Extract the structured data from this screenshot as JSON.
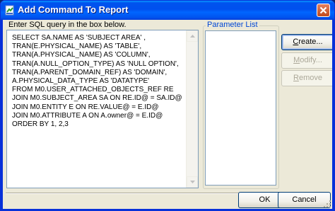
{
  "window": {
    "title": "Add Command To Report"
  },
  "prompt": "Enter SQL query in the box below.",
  "sql_lines": [
    "SELECT SA.NAME AS 'SUBJECT AREA' ,",
    "TRAN(E.PHYSICAL_NAME) AS 'TABLE',",
    "TRAN(A.PHYSICAL_NAME) AS 'COLUMN',",
    "TRAN(A.NULL_OPTION_TYPE) AS 'NULL OPTION',",
    "TRAN(A.PARENT_DOMAIN_REF) AS 'DOMAIN',",
    "A.PHYSICAL_DATA_TYPE AS 'DATATYPE'",
    "FROM M0.USER_ATTACHED_OBJECTS_REF RE",
    "JOIN M0.SUBJECT_AREA SA ON RE.ID@ = SA.ID@",
    "JOIN M0.ENTITY E ON RE.VALUE@ = E.ID@",
    "JOIN M0.ATTRIBUTE A ON A.owner@ = E.ID@",
    "ORDER BY 1, 2,3"
  ],
  "parameter_list": {
    "legend": "Parameter List"
  },
  "buttons": {
    "create": {
      "label": "Create...",
      "enabled": true
    },
    "modify": {
      "label": "Modify...",
      "enabled": false
    },
    "remove": {
      "label": "Remove",
      "enabled": false
    },
    "ok": "OK",
    "cancel": "Cancel"
  },
  "icons": {
    "app": "app-icon",
    "close": "close-icon"
  },
  "colors": {
    "title_bar": "#0053ee",
    "frame": "#0831d9",
    "dialog_bg": "#ece9d8",
    "group_legend": "#0046d5"
  }
}
